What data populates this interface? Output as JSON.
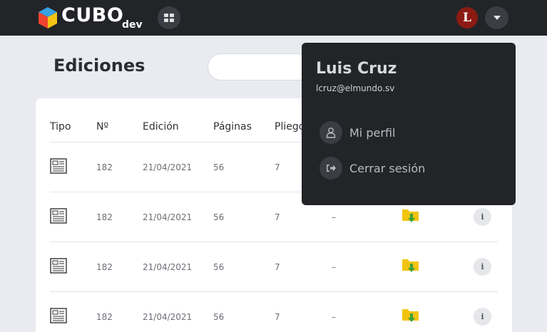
{
  "header": {
    "brand": "CUBO",
    "brand_sub": "dev",
    "avatar_letter": "L"
  },
  "page": {
    "title": "Ediciones"
  },
  "table": {
    "columns": [
      "Tipo",
      "Nº",
      "Edición",
      "Páginas",
      "Pliegos"
    ],
    "rows": [
      {
        "tipo": "newspaper-icon",
        "numero": "182",
        "edicion": "21/04/2021",
        "paginas": "56",
        "pliegos": "7",
        "extra": "",
        "archivo": "",
        "info": ""
      },
      {
        "tipo": "newspaper-icon",
        "numero": "182",
        "edicion": "21/04/2021",
        "paginas": "56",
        "pliegos": "7",
        "extra": "–",
        "archivo": "folder-download-icon",
        "info": "i"
      },
      {
        "tipo": "newspaper-icon",
        "numero": "182",
        "edicion": "21/04/2021",
        "paginas": "56",
        "pliegos": "7",
        "extra": "–",
        "archivo": "folder-download-icon",
        "info": "i"
      },
      {
        "tipo": "newspaper-icon",
        "numero": "182",
        "edicion": "21/04/2021",
        "paginas": "56",
        "pliegos": "7",
        "extra": "–",
        "archivo": "folder-download-icon",
        "info": "i"
      }
    ]
  },
  "user_menu": {
    "name": "Luis Cruz",
    "email": "lcruz@elmundo.sv",
    "items": [
      {
        "label": "Mi perfil",
        "icon": "user-icon"
      },
      {
        "label": "Cerrar sesión",
        "icon": "logout-icon"
      }
    ]
  },
  "colors": {
    "topbar": "#222428",
    "background": "#e9ebf0",
    "avatar": "#8b1a13",
    "folder": "#f2c40f",
    "arrow": "#3aa13a"
  }
}
